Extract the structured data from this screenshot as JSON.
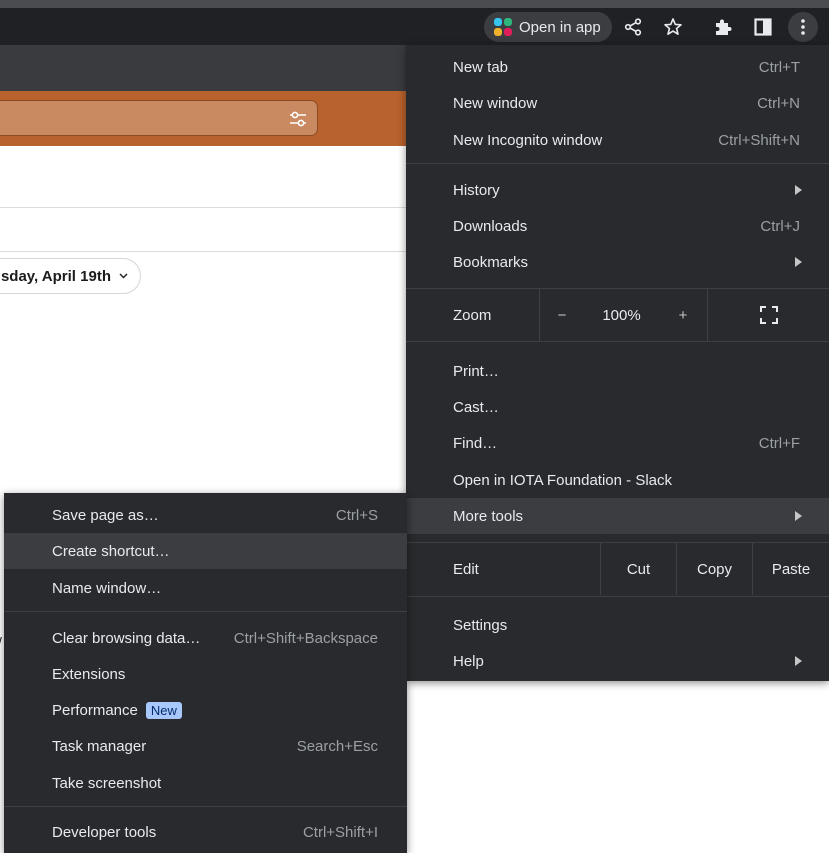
{
  "toolbar": {
    "open_in_app_label": "Open in app",
    "icons": [
      "slack-logo",
      "share-icon",
      "star-icon",
      "extensions-icon",
      "side-panel-icon",
      "more-vert-icon"
    ]
  },
  "page": {
    "date_label": "sday, April 19th",
    "stray_text": "/"
  },
  "main_menu": {
    "new_tab": {
      "label": "New tab",
      "shortcut": "Ctrl+T"
    },
    "new_window": {
      "label": "New window",
      "shortcut": "Ctrl+N"
    },
    "new_incognito": {
      "label": "New Incognito window",
      "shortcut": "Ctrl+Shift+N"
    },
    "history": {
      "label": "History"
    },
    "downloads": {
      "label": "Downloads",
      "shortcut": "Ctrl+J"
    },
    "bookmarks": {
      "label": "Bookmarks"
    },
    "zoom": {
      "label": "Zoom",
      "minus": "−",
      "value": "100%",
      "plus": "+"
    },
    "print": {
      "label": "Print…"
    },
    "cast": {
      "label": "Cast…"
    },
    "find": {
      "label": "Find…",
      "shortcut": "Ctrl+F"
    },
    "open_in": {
      "label": "Open in IOTA Foundation - Slack"
    },
    "more_tools": {
      "label": "More tools"
    },
    "edit": {
      "label": "Edit",
      "cut": "Cut",
      "copy": "Copy",
      "paste": "Paste"
    },
    "settings": {
      "label": "Settings"
    },
    "help": {
      "label": "Help"
    }
  },
  "sub_menu": {
    "save_page": {
      "label": "Save page as…",
      "shortcut": "Ctrl+S"
    },
    "create_shortcut": {
      "label": "Create shortcut…"
    },
    "name_window": {
      "label": "Name window…"
    },
    "clear_data": {
      "label": "Clear browsing data…",
      "shortcut": "Ctrl+Shift+Backspace"
    },
    "extensions": {
      "label": "Extensions"
    },
    "performance": {
      "label": "Performance",
      "badge": "New"
    },
    "task_manager": {
      "label": "Task manager",
      "shortcut": "Search+Esc"
    },
    "screenshot": {
      "label": "Take screenshot"
    },
    "dev_tools": {
      "label": "Developer tools",
      "shortcut": "Ctrl+Shift+I"
    }
  },
  "colors": {
    "menu_bg": "#292a2d",
    "highlight": "#3c3d41",
    "brand_orange": "#b8622d",
    "badge_bg": "#a8c7fa"
  }
}
